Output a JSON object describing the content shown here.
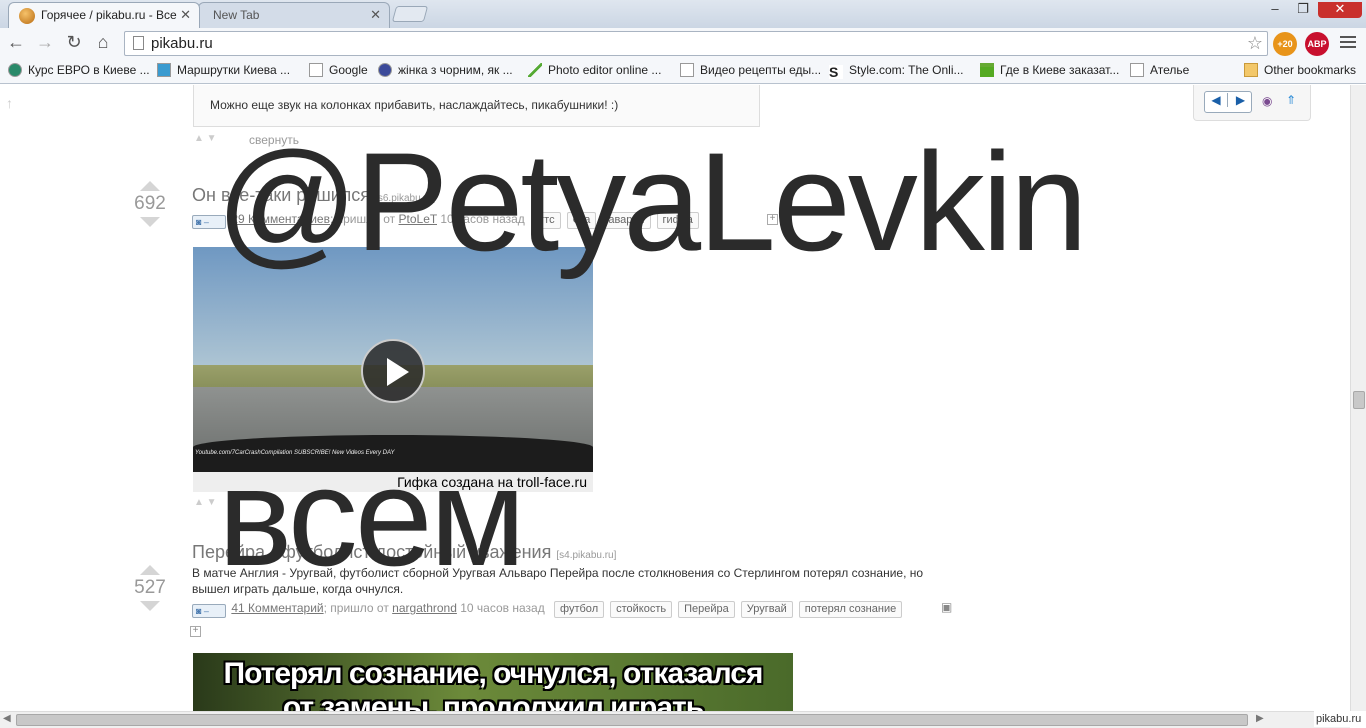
{
  "browser": {
    "tabs": [
      {
        "title": "Горячее / pikabu.ru - Все",
        "active": true
      },
      {
        "title": "New Tab",
        "active": false
      }
    ],
    "window_controls": {
      "minimize": "–",
      "restore": "❐",
      "close": "✕"
    },
    "url": "pikabu.ru",
    "extensions": [
      {
        "name": "notifications-extension",
        "badge": "+20",
        "color": "#e84c1a"
      },
      {
        "name": "adblock-plus-extension",
        "badge": "ABP",
        "color": "#c8102e"
      }
    ],
    "bookmarks": [
      "Курс ЕВРО в Киеве ...",
      "Маршрутки Киева ...",
      "Google",
      "жінка з чорним, як ...",
      "Photo editor online ...",
      "Видео рецепты еды...",
      "Style.com: The Onli...",
      "Где в Киеве заказат...",
      "Ателье",
      "Other bookmarks"
    ]
  },
  "page": {
    "comment_text": "Можно еще звук на колонках прибавить, наслаждайтесь, пикабушники! :)",
    "collapse_label": "свернуть",
    "posts": [
      {
        "score": "692",
        "title": "Он все-таки решился",
        "source": "[s6.pikabu.ru]",
        "comments": "29 Комментариев",
        "meta_rest": "; пришло от ",
        "author": "PtoLeT",
        "time": " 10 часов назад",
        "tags": [
          "гтс",
          "Gta",
          "авария",
          "гифка"
        ],
        "gif_caption": "Гифка создана на troll-face.ru",
        "gif_watermark": "Youtube.com/7CarCrashCompilation SUBSCRIBE! New Videos Every DAY"
      },
      {
        "score": "527",
        "title": "Перейра - футболист достойный уважения",
        "source": "[s4.pikabu.ru]",
        "description": "В матче Англия - Уругвай, футболист сборной Уругвая Альваро Перейра после столкновения со Стерлингом потерял сознание, но вышел играть дальше, когда очнулся.",
        "comments": "41 Комментарий",
        "meta_rest": "; пришло от ",
        "author": "nargathrond",
        "time": " 10 часов назад",
        "tags": [
          "футбол",
          "стойкость",
          "Перейра",
          "Уругвай",
          "потерял сознание"
        ],
        "image_text_line1": "Потерял сознание, очнулся, отказался",
        "image_text_line2": "от замены, продолжил играть"
      }
    ],
    "overlay_watermark_line1": "@PetyaLevkin",
    "overlay_watermark_line2": "всем",
    "corner_watermark": "pikabu.ru"
  }
}
